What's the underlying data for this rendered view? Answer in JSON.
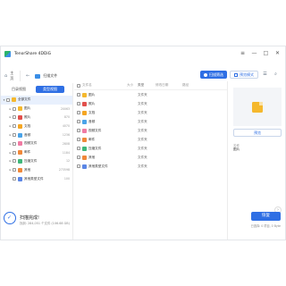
{
  "window": {
    "title": "TenorShare 4DDiG",
    "controls": [
      "≡",
      "—",
      "□",
      "✕"
    ]
  },
  "nav": {
    "home_label": "主页",
    "current_label": "扫描文件",
    "filter_label": "扫描筛选",
    "preview_label": "预览模式"
  },
  "sidebar": {
    "tabs": [
      "目录视图",
      "类型视图"
    ],
    "active_tab": 1,
    "items": [
      {
        "label": "全部文件",
        "count": "",
        "color": "#f5b82e",
        "expand": "▾",
        "level": 0
      },
      {
        "label": "图片",
        "count": "20063",
        "color": "#f5b82e",
        "expand": "▸",
        "level": 1
      },
      {
        "label": "照片",
        "count": "870",
        "color": "#e2504c",
        "expand": "▸",
        "level": 1
      },
      {
        "label": "文档",
        "count": "4070",
        "color": "#f5a623",
        "expand": "▸",
        "level": 1
      },
      {
        "label": "音频",
        "count": "1236",
        "color": "#4aa3e8",
        "expand": "▸",
        "level": 1
      },
      {
        "label": "视频文件",
        "count": "2808",
        "color": "#f07ba3",
        "expand": "▸",
        "level": 1
      },
      {
        "label": "邮件",
        "count": "1184",
        "color": "#f0883a",
        "expand": "▸",
        "level": 1
      },
      {
        "label": "压缩文件",
        "count": "12",
        "color": "#3fb77a",
        "expand": "▸",
        "level": 1
      },
      {
        "label": "其他",
        "count": "273598",
        "color": "#f0883a",
        "expand": "▸",
        "level": 1
      },
      {
        "label": "其他类型文件",
        "count": "100",
        "color": "#5b86e5",
        "expand": "",
        "level": 1
      }
    ]
  },
  "table": {
    "headers": [
      "文件名",
      "大小",
      "类型",
      "修改日期",
      "路径"
    ],
    "rows": [
      {
        "name": "图片",
        "type": "文件夹",
        "color": "#f5b82e"
      },
      {
        "name": "照片",
        "type": "文件夹",
        "color": "#e2504c"
      },
      {
        "name": "文档",
        "type": "文件夹",
        "color": "#f5a623"
      },
      {
        "name": "音频",
        "type": "文件夹",
        "color": "#4aa3e8"
      },
      {
        "name": "视频文件",
        "type": "文件夹",
        "color": "#f07ba3"
      },
      {
        "name": "邮件",
        "type": "文件夹",
        "color": "#f0883a"
      },
      {
        "name": "压缩文件",
        "type": "文件夹",
        "color": "#3fb77a"
      },
      {
        "name": "其他",
        "type": "文件夹",
        "color": "#f0883a"
      },
      {
        "name": "其他类型文件",
        "type": "文件夹",
        "color": "#5b86e5"
      }
    ]
  },
  "preview": {
    "button_label": "预览",
    "field_label": "名称",
    "field_value": "图片"
  },
  "status": {
    "title": "扫描完成!",
    "subtitle": "找到: 284,051 个文件 (106.68 GB)",
    "recover_label": "恢复",
    "selection": "已选择: 0 项目, 0 Byte"
  },
  "colors": {
    "accent": "#2f6fe4",
    "selection_bg": "#e8f0fd"
  }
}
